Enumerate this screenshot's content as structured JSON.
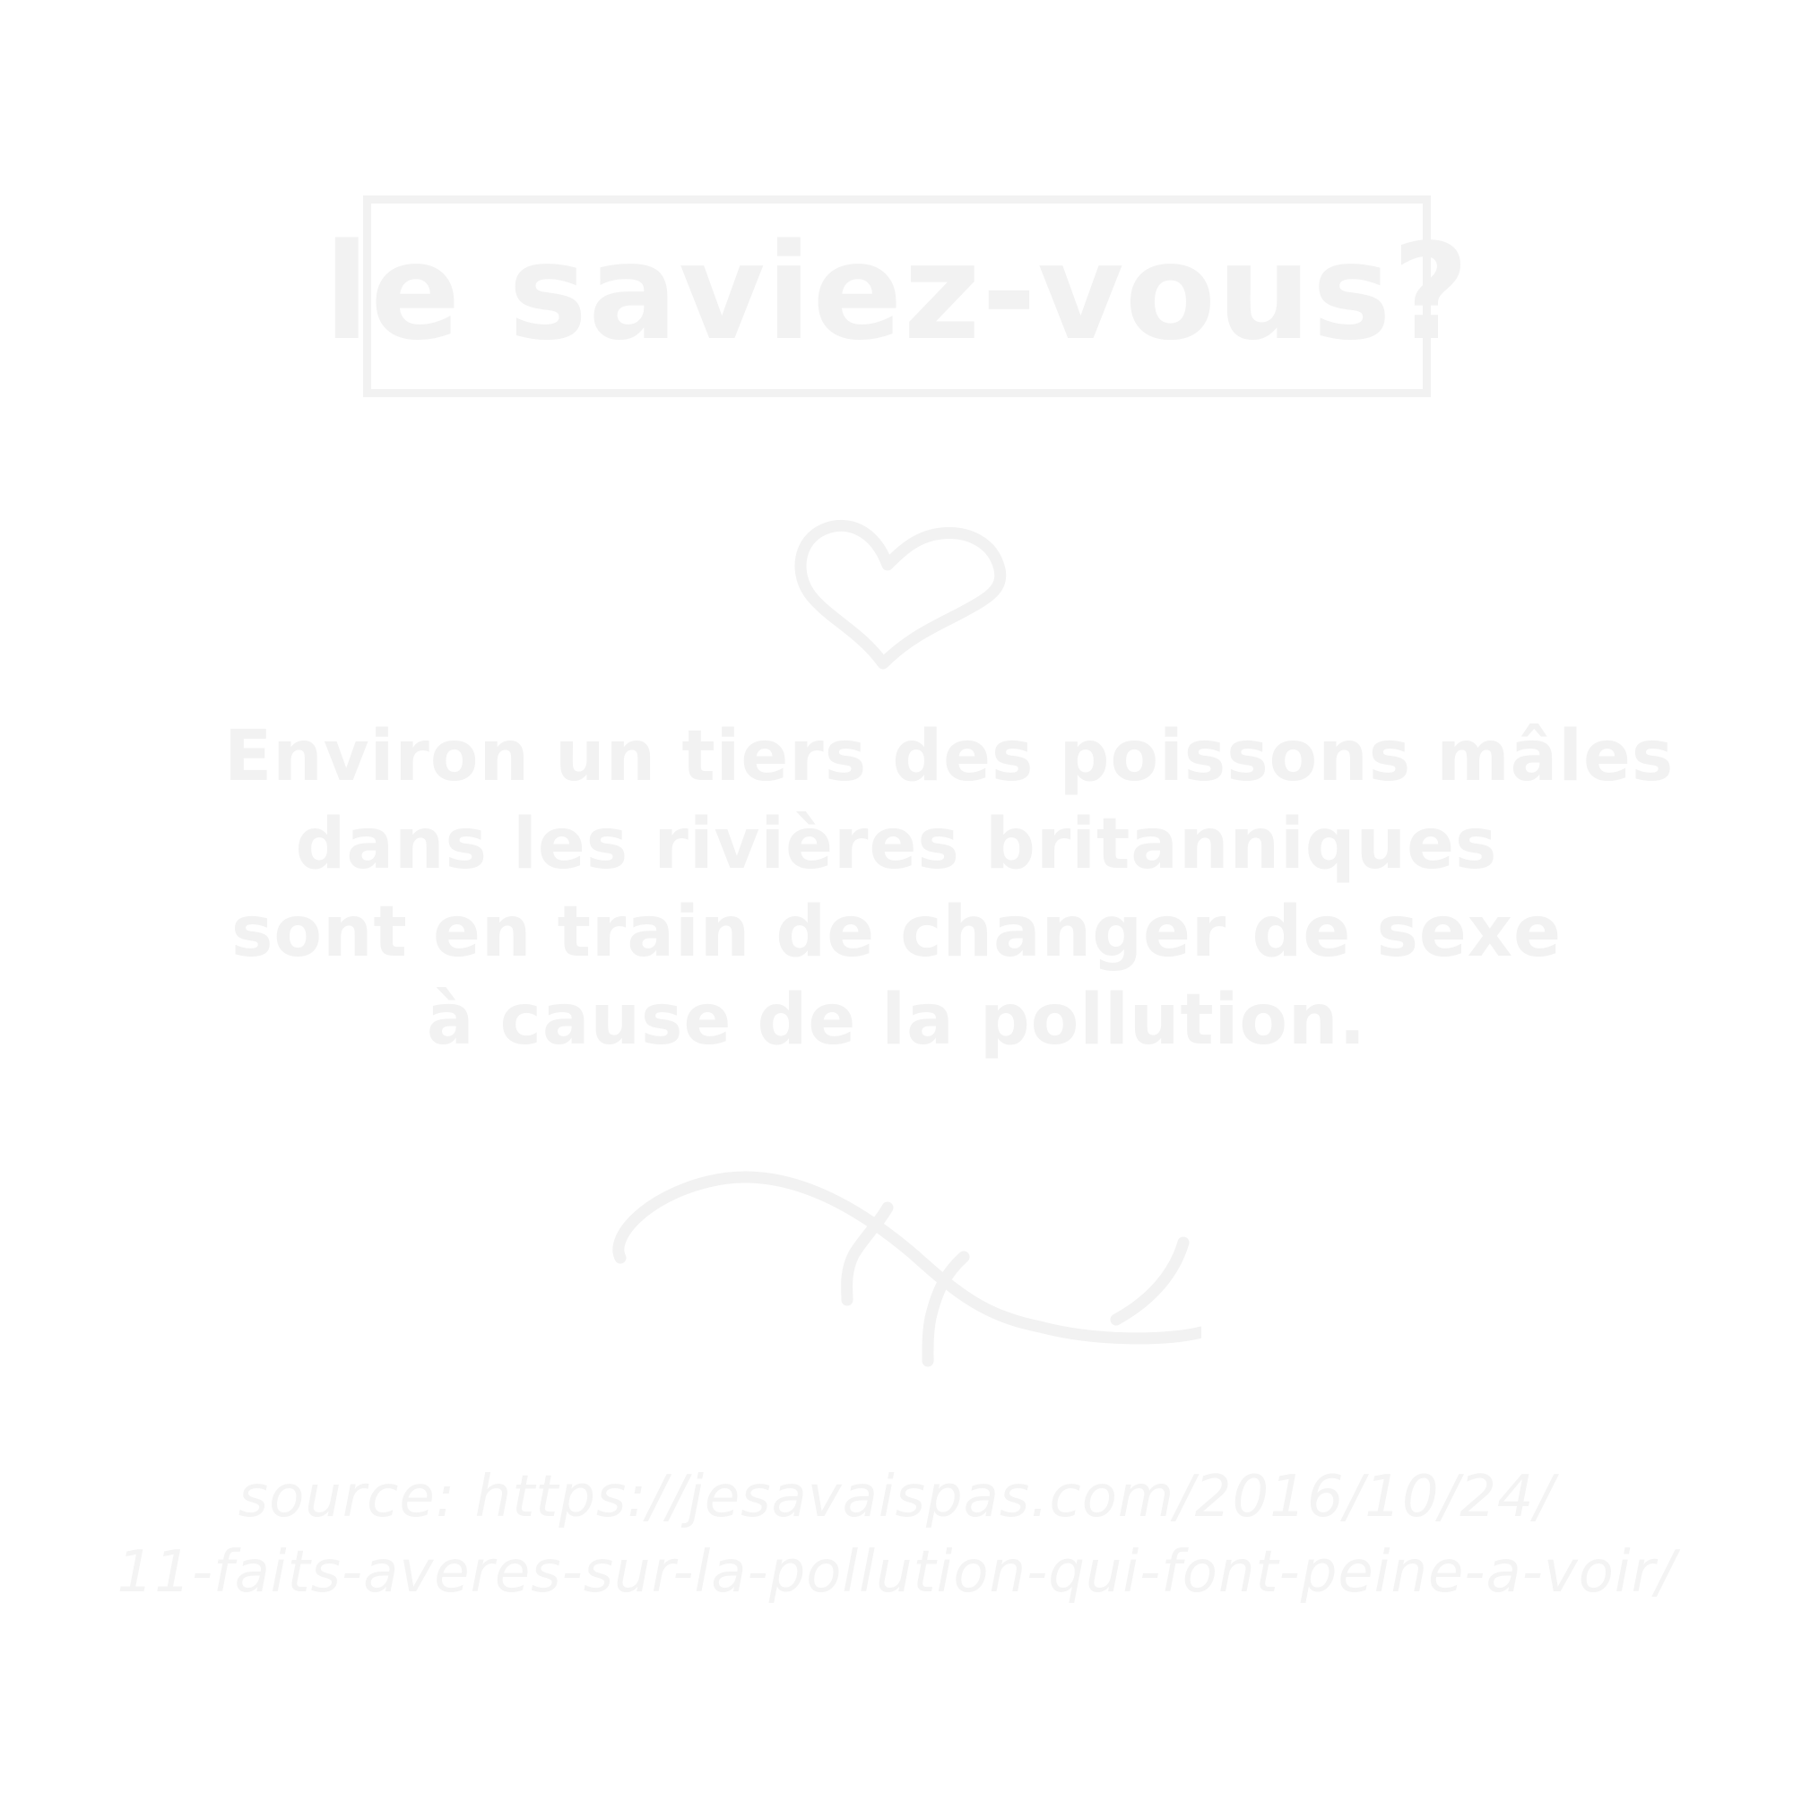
{
  "title": "le saviez-vous?",
  "fact": {
    "lines": [
      "Environ un tiers des poissons mâles",
      "dans les rivières britanniques",
      "sont en train de changer de sexe",
      "à cause de la pollution."
    ]
  },
  "source": {
    "lines": [
      "source: https://jesavaispas.com/2016/10/24/",
      "11-faits-averes-sur-la-pollution-qui-font-peine-a-voir/"
    ]
  },
  "icons": {
    "heart": "heart-icon",
    "flourish": "flourish-icon"
  },
  "colors": {
    "background": "#ffffff",
    "ink": "#f2f2f2"
  }
}
